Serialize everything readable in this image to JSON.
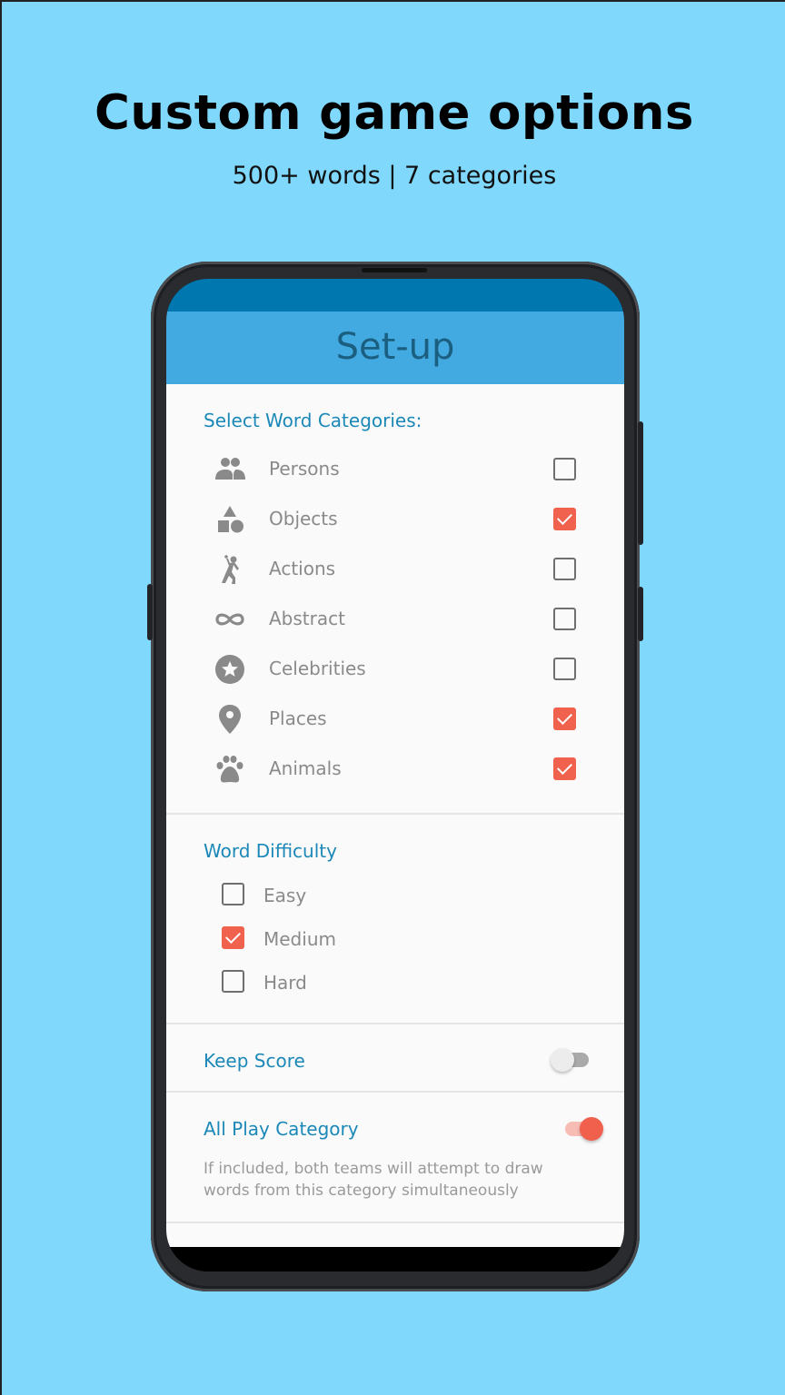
{
  "promo": {
    "headline": "Custom game options",
    "subline": "500+ words | 7 categories"
  },
  "app": {
    "title": "Set-up",
    "colors": {
      "statusbar": "#0077ae",
      "appbar": "#42a9e1",
      "accent": "#f0624d",
      "section_title": "#1b88b8",
      "background": "#80d9fd"
    }
  },
  "categories": {
    "title": "Select Word Categories:",
    "items": [
      {
        "label": "Persons",
        "icon": "people-icon",
        "checked": false
      },
      {
        "label": "Objects",
        "icon": "shapes-icon",
        "checked": true
      },
      {
        "label": "Actions",
        "icon": "running-person-icon",
        "checked": false
      },
      {
        "label": "Abstract",
        "icon": "infinity-icon",
        "checked": false
      },
      {
        "label": "Celebrities",
        "icon": "star-circle-icon",
        "checked": false
      },
      {
        "label": "Places",
        "icon": "location-pin-icon",
        "checked": true
      },
      {
        "label": "Animals",
        "icon": "paw-icon",
        "checked": true
      }
    ]
  },
  "difficulty": {
    "title": "Word Difficulty",
    "items": [
      {
        "label": "Easy",
        "checked": false
      },
      {
        "label": "Medium",
        "checked": true
      },
      {
        "label": "Hard",
        "checked": false
      }
    ]
  },
  "keep_score": {
    "label": "Keep Score",
    "on": false
  },
  "all_play": {
    "label": "All Play Category",
    "on": true,
    "description": "If included, both teams will attempt to draw words from this category simultaneously"
  }
}
